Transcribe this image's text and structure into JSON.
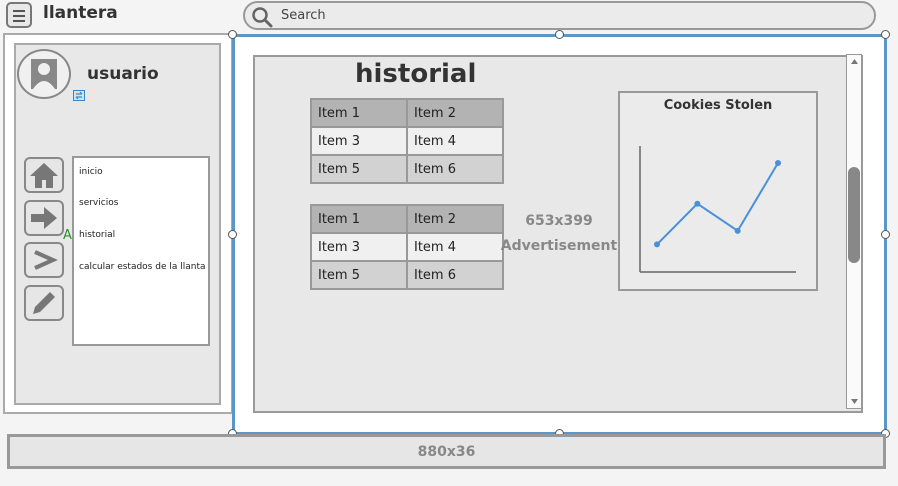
{
  "app": {
    "title": "llantera"
  },
  "search": {
    "placeholder": "Search"
  },
  "user": {
    "name": "usuario"
  },
  "sidebar": {
    "stray_label": "A",
    "items": [
      {
        "label": "inicio"
      },
      {
        "label": "servicios"
      },
      {
        "label": "historial"
      },
      {
        "label": "calcular estados de la llanta"
      }
    ],
    "icons": [
      "home-icon",
      "arrow-right-icon",
      "chevron-right-icon",
      "pencil-icon"
    ]
  },
  "main": {
    "title": "historial",
    "tables": [
      {
        "rows": [
          [
            "Item 1",
            "Item 2"
          ],
          [
            "Item 3",
            "Item 4"
          ],
          [
            "Item 5",
            "Item 6"
          ]
        ]
      },
      {
        "rows": [
          [
            "Item 1",
            "Item 2"
          ],
          [
            "Item 3",
            "Item 4"
          ],
          [
            "Item 5",
            "Item 6"
          ]
        ]
      }
    ],
    "advertisement": {
      "size": "653x399",
      "label": "Advertisement"
    }
  },
  "chart_data": {
    "type": "line",
    "title": "Cookies Stolen",
    "x": [
      1,
      2,
      3,
      4
    ],
    "series": [
      {
        "values": [
          1,
          4,
          2,
          7
        ],
        "color": "#4a90d9"
      }
    ],
    "ylim": [
      0,
      8
    ],
    "xlabel": "",
    "ylabel": "",
    "grid": false
  },
  "footer": {
    "label": "880x36"
  },
  "colors": {
    "selection_accent": "#5a96c8",
    "chart_line": "#4a90d9",
    "stray_label": "#2f8a2f"
  }
}
